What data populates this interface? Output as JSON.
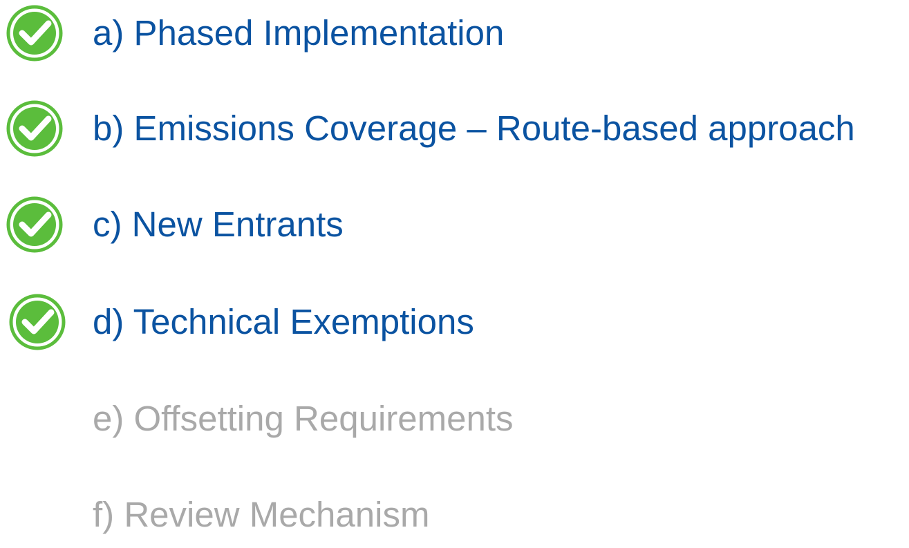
{
  "items": [
    {
      "label": "a) Phased Implementation",
      "status": "done",
      "icon": "green-check-circle-icon"
    },
    {
      "label": "b) Emissions Coverage – Route-based approach",
      "status": "done",
      "icon": "green-check-circle-icon"
    },
    {
      "label": "c) New Entrants",
      "status": "done",
      "icon": "green-check-circle-icon"
    },
    {
      "label": "d) Technical Exemptions",
      "status": "done",
      "icon": "green-check-circle-icon"
    },
    {
      "label": "e) Offsetting Requirements",
      "status": "pending"
    },
    {
      "label": "f) Review Mechanism",
      "status": "pending"
    }
  ],
  "colors": {
    "done_text": "#0b53a1",
    "pending_text": "#a9a9a9",
    "check_green": "#5bbd3c",
    "check_ring": "#5bbd3c"
  }
}
